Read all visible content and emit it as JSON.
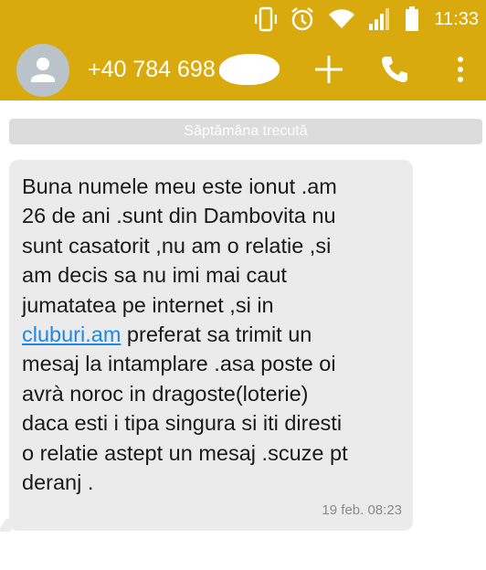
{
  "status_bar": {
    "time": "11:33",
    "icons": [
      "vibrate-icon",
      "alarm-icon",
      "wifi-icon",
      "signal-icon",
      "battery-icon"
    ]
  },
  "app_bar": {
    "contact_number": "+40 784 698",
    "accent_color": "#d8aa0e",
    "actions": [
      "add-icon",
      "phone-icon",
      "more-vert-icon"
    ]
  },
  "conversation": {
    "date_divider": "Săptămâna trecută",
    "messages": [
      {
        "text_before_link": "Buna numele meu este ionut .am\n26 de ani .sunt din Dambovita nu\nsunt casatorit ,nu am o relatie ,si\nam decis sa nu imi mai caut\njumatatea pe internet ,si in\n",
        "link": "cluburi.am",
        "text_after_link": " preferat sa trimit un\nmesaj la intamplare .asa poste oi\navrà noroc in dragoste(loterie)\ndaca esti i tipa singura si iti diresti\no relatie astept un mesaj .scuze pt\nderanj .",
        "timestamp": "19 feb. 08:23"
      }
    ]
  }
}
